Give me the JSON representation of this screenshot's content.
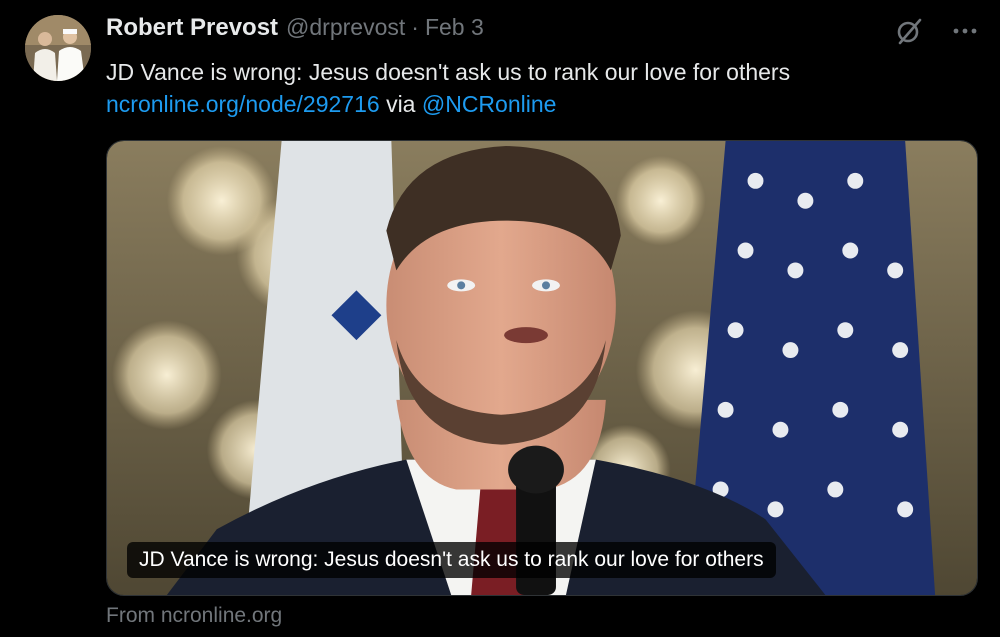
{
  "tweet": {
    "author_name": "Robert Prevost",
    "author_handle": "@drprevost",
    "separator": "·",
    "date": "Feb 3",
    "text": "JD Vance is wrong: Jesus doesn't ask us to rank our love for others",
    "link_text": "ncronline.org/node/292716",
    "via_text": "via",
    "mention": "@NCRonline"
  },
  "card": {
    "caption": "JD Vance is wrong: Jesus doesn't ask us to rank our love for others",
    "source": "From ncronline.org"
  },
  "icons": {
    "grok": "slashed-circle-icon",
    "more": "more-icon"
  },
  "colors": {
    "background": "#000000",
    "text": "#e7e9ea",
    "muted": "#71767b",
    "link": "#1d9bf0"
  }
}
